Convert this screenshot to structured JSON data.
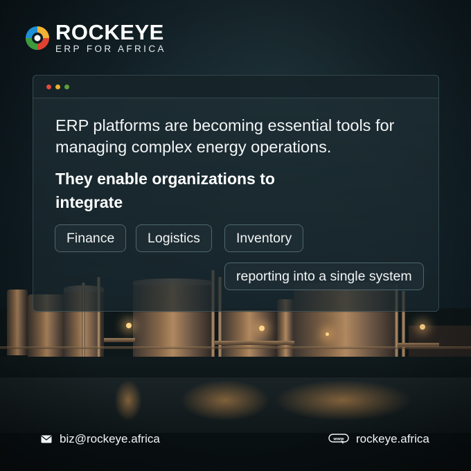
{
  "brand": {
    "name": "ROCKEYE",
    "tagline": "ERP FOR AFRICA",
    "logo_icon": "swirl-logo-icon"
  },
  "window": {
    "dots": [
      "#e14b3b",
      "#e6b12e",
      "#5aa03c"
    ]
  },
  "content": {
    "headline": "ERP platforms are becoming essential tools for managing complex energy operations.",
    "subhead": "They enable organizations to integrate",
    "chips": [
      "Finance",
      "Logistics",
      "Inventory"
    ],
    "note": "reporting into a single system"
  },
  "footer": {
    "email": "biz@rockeye.africa",
    "email_icon": "mail-icon",
    "website": "rockeye.africa",
    "website_icon": "www-icon"
  },
  "colors": {
    "background": "#0c161b",
    "panel": "#1e2e34",
    "accent_light": "#ffd48a"
  }
}
